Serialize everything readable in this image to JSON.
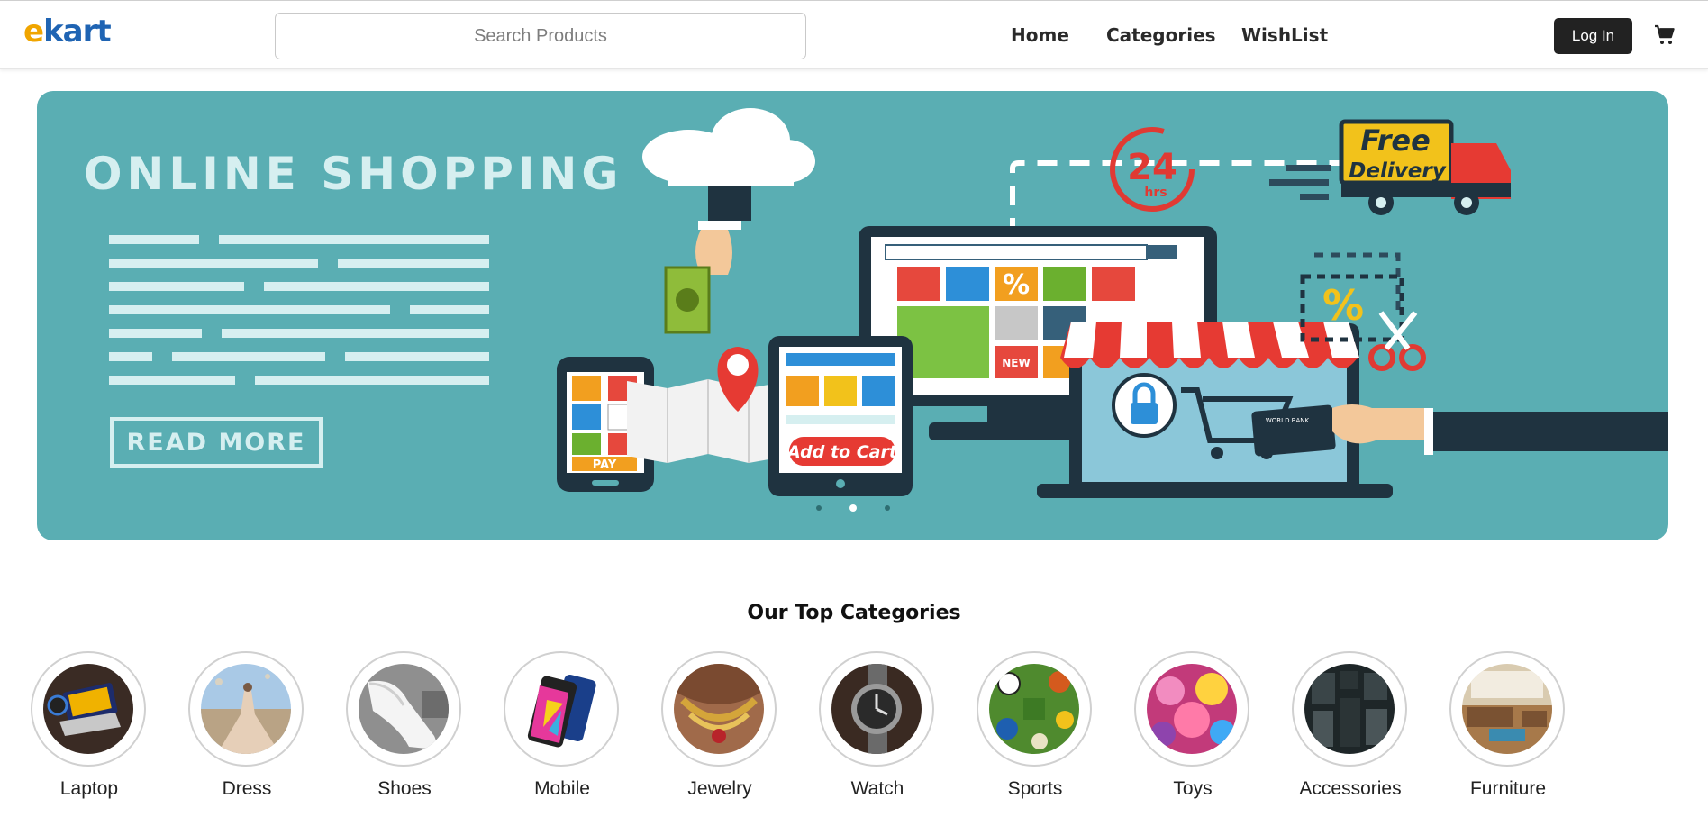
{
  "brand": {
    "logo_e": "e",
    "logo_rest": "kart"
  },
  "search": {
    "placeholder": "Search Products",
    "value": ""
  },
  "nav": {
    "home": "Home",
    "categories": "Categories",
    "wishlist": "WishList"
  },
  "header": {
    "login_label": "Log In",
    "cart_icon": "cart-icon"
  },
  "banner": {
    "title": "ONLINE SHOPPING",
    "read_more": "READ MORE",
    "free_line1": "Free",
    "free_line2": "Delivery",
    "hours_number": "24",
    "hours_unit": "hrs",
    "add_to_cart": "Add to Cart",
    "pay_label": "PAY",
    "card_bank": "WORLD BANK",
    "percent": "%",
    "new_badge": "NEW",
    "slides_total": 3,
    "active_slide": 2
  },
  "categories": {
    "title": "Our Top Categories",
    "items": [
      {
        "label": "Laptop",
        "icon": "laptop-icon"
      },
      {
        "label": "Dress",
        "icon": "dress-icon"
      },
      {
        "label": "Shoes",
        "icon": "shoes-icon"
      },
      {
        "label": "Mobile",
        "icon": "mobile-icon"
      },
      {
        "label": "Jewelry",
        "icon": "jewelry-icon"
      },
      {
        "label": "Watch",
        "icon": "watch-icon"
      },
      {
        "label": "Sports",
        "icon": "sports-icon"
      },
      {
        "label": "Toys",
        "icon": "toys-icon"
      },
      {
        "label": "Accessories",
        "icon": "accessories-icon"
      },
      {
        "label": "Furniture",
        "icon": "furniture-icon"
      }
    ]
  },
  "colors": {
    "brand_orange": "#f0a500",
    "brand_blue": "#1f64b3",
    "banner_teal": "#5aaeb3",
    "login_bg": "#222222"
  }
}
